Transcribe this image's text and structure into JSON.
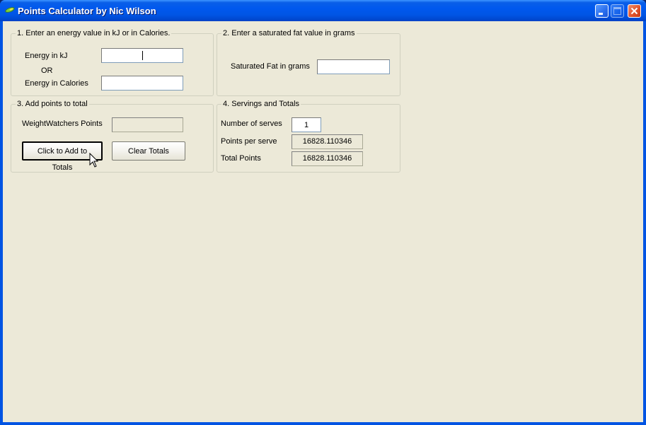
{
  "window": {
    "title": "Points Calculator by Nic Wilson",
    "controls": [
      "minimize",
      "maximize",
      "close"
    ]
  },
  "group1": {
    "legend": "1. Enter an energy value in kJ or in Calories.",
    "energy_kj_label": "Energy in kJ",
    "energy_kj_value": "",
    "or_label": "OR",
    "energy_cal_label": "Energy in Calories",
    "energy_cal_value": ""
  },
  "group2": {
    "legend": "2. Enter a saturated fat value in grams",
    "sat_fat_label": "Saturated Fat in grams",
    "sat_fat_value": ""
  },
  "group3": {
    "legend": "3. Add points to total",
    "ww_points_label": "WeightWatchers Points",
    "ww_points_value": "",
    "add_button": "Click to Add to Totals",
    "clear_button": "Clear Totals"
  },
  "group4": {
    "legend": "4. Servings and Totals",
    "serves_label": "Number of serves",
    "serves_value": "1",
    "per_serve_label": "Points per serve",
    "per_serve_value": "16828.110346",
    "total_label": "Total Points",
    "total_value": "16828.110346"
  }
}
